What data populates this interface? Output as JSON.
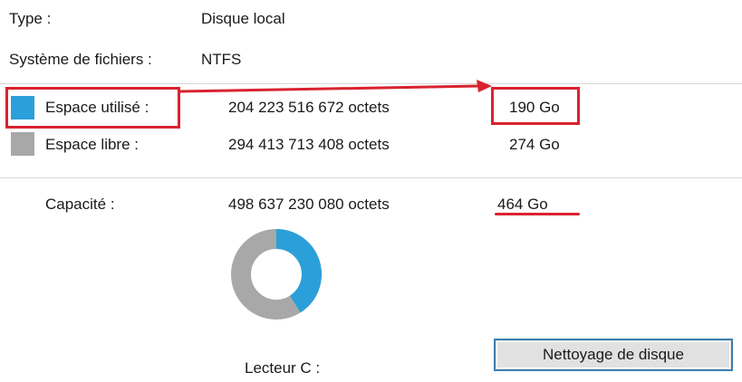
{
  "general": {
    "type_label": "Type :",
    "type_value": "Disque local",
    "fs_label": "Système de fichiers :",
    "fs_value": "NTFS"
  },
  "used": {
    "label": "Espace utilisé :",
    "bytes": "204 223 516 672 octets",
    "size": "190 Go",
    "color": "#2b9fd9"
  },
  "free": {
    "label": "Espace libre :",
    "bytes": "294 413 713 408 octets",
    "size": "274 Go",
    "color": "#a8a8a8"
  },
  "capacity": {
    "label": "Capacité :",
    "bytes": "498 637 230 080 octets",
    "size": "464 Go"
  },
  "drive": {
    "label": "Lecteur C :",
    "used_fraction": 0.4096
  },
  "buttons": {
    "cleanup": "Nettoyage de disque"
  },
  "annotations": {
    "color": "#d9232e"
  }
}
